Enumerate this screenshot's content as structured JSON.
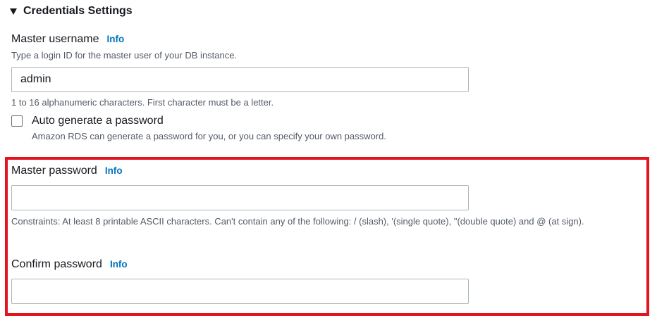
{
  "section": {
    "title": "Credentials Settings"
  },
  "master_username": {
    "label": "Master username",
    "info": "Info",
    "description": "Type a login ID for the master user of your DB instance.",
    "value": "admin",
    "hint": "1 to 16 alphanumeric characters. First character must be a letter."
  },
  "auto_generate": {
    "label": "Auto generate a password",
    "description": "Amazon RDS can generate a password for you, or you can specify your own password.",
    "checked": false
  },
  "master_password": {
    "label": "Master password",
    "info": "Info",
    "value": "",
    "constraints": "Constraints: At least 8 printable ASCII characters. Can't contain any of the following: / (slash), '(single quote), \"(double quote) and @ (at sign)."
  },
  "confirm_password": {
    "label": "Confirm password",
    "info": "Info",
    "value": ""
  },
  "colors": {
    "link": "#0073bb",
    "highlight": "#e3131f",
    "border": "#aab7b8",
    "text": "#16191f",
    "secondary_text": "#545b64"
  },
  "icons": {
    "section_toggle": "caret-down-icon",
    "checkbox": "checkbox-unchecked-icon"
  }
}
